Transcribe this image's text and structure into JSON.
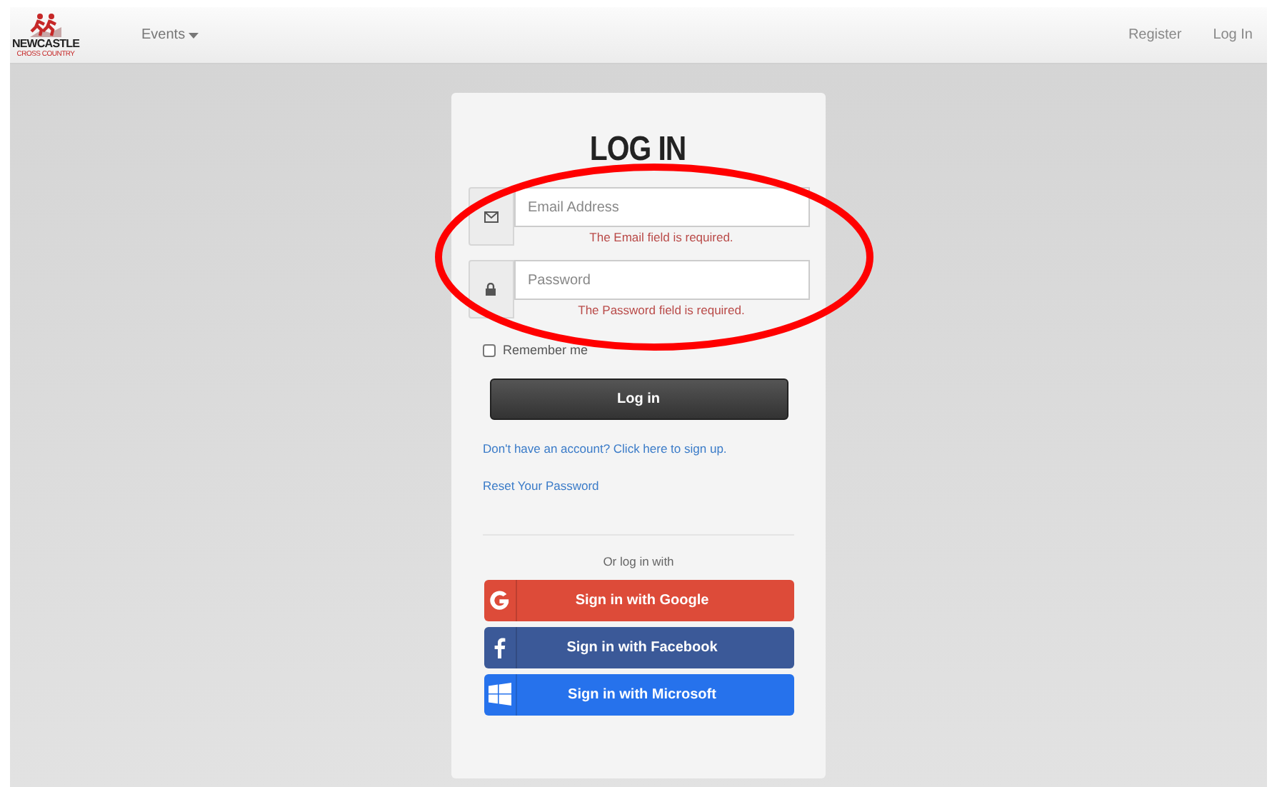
{
  "navbar": {
    "logo": {
      "title": "NEWCASTLE",
      "subtitle": "CROSS COUNTRY"
    },
    "menu": [
      {
        "label": "Events",
        "dropdown": true
      }
    ],
    "links": [
      "Register",
      "Log In"
    ]
  },
  "form": {
    "title": "LOG IN",
    "fields": [
      {
        "kind": "email",
        "placeholder": "Email Address",
        "error": "The Email field is required."
      },
      {
        "kind": "password",
        "placeholder": "Password",
        "error": "The Password field is required."
      }
    ],
    "remember": {
      "label": "Remember me",
      "checked": false
    },
    "submit": "Log in",
    "links": [
      "Don't have an account? Click here to sign up.",
      "Reset Your Password"
    ],
    "divider_text": "Or log in with",
    "providers": [
      {
        "kind": "google",
        "label": "Sign in with Google",
        "color": "#dd4b39"
      },
      {
        "kind": "facebook",
        "label": "Sign in with Facebook",
        "color": "#3b5998"
      },
      {
        "kind": "microsoft",
        "label": "Sign in with Microsoft",
        "color": "#2672ec"
      }
    ]
  },
  "annotation": {
    "kind": "ellipse"
  }
}
